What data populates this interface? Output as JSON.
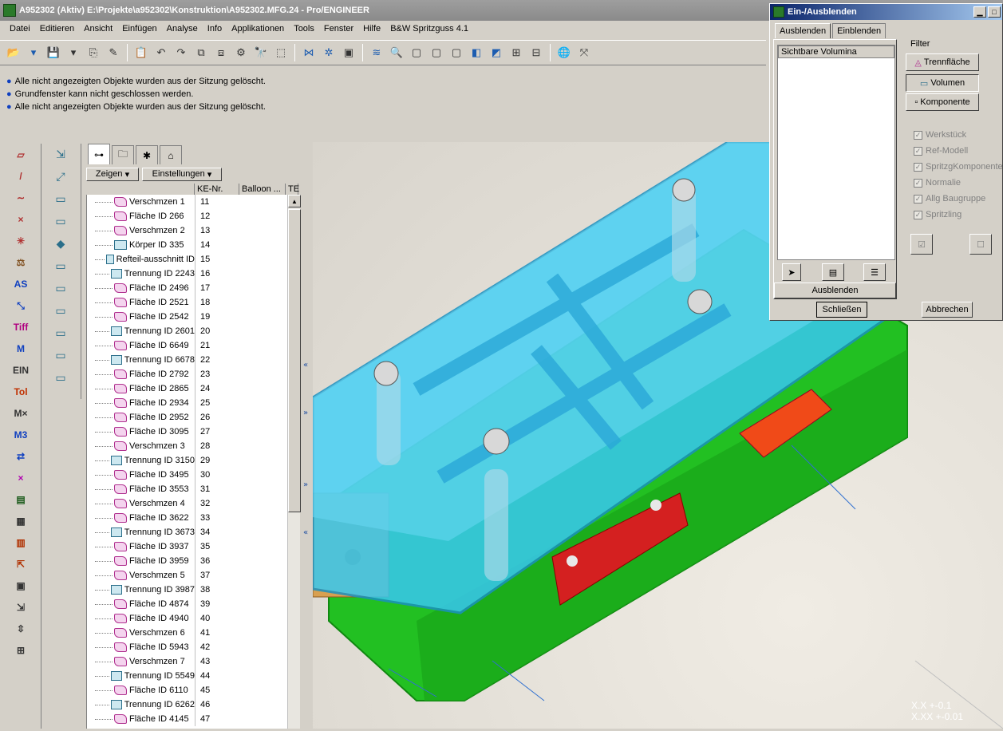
{
  "window": {
    "title": "A952302 (Aktiv) E:\\Projekte\\a952302\\Konstruktion\\A952302.MFG.24 - Pro/ENGINEER"
  },
  "menu": [
    "Datei",
    "Editieren",
    "Ansicht",
    "Einfügen",
    "Analyse",
    "Info",
    "Applikationen",
    "Tools",
    "Fenster",
    "Hilfe",
    "B&W Spritzguss 4.1"
  ],
  "messages": [
    "Alle nicht angezeigten Objekte wurden aus der Sitzung gelöscht.",
    "Grundfenster kann nicht geschlossen werden.",
    "Alle nicht angezeigten Objekte wurden aus der Sitzung gelöscht."
  ],
  "lefttools": [
    "▱",
    "/",
    "∼",
    "×",
    "✳",
    "⚖",
    "AS",
    "⤡",
    "Tiff",
    "M",
    "EIN",
    "Tol",
    "M×",
    "M3",
    "⇄",
    "×",
    "▤",
    "▦",
    "▥",
    "⇱",
    "▣",
    "⇲",
    "⇳",
    "⊞"
  ],
  "midtools": [
    "⇲",
    "⤢",
    "▭",
    "▭",
    "◆",
    "▭",
    "▭",
    "▭",
    "▭",
    "▭",
    "▭"
  ],
  "tree": {
    "show_button": "Zeigen",
    "settings_button": "Einstellungen",
    "columns": [
      "KE-Nr.",
      "Balloon ...",
      "TE"
    ],
    "rows": [
      {
        "name": "Verschmzen 1",
        "nr": "11",
        "type": "srf"
      },
      {
        "name": "Fläche ID 266",
        "nr": "12",
        "type": "srf"
      },
      {
        "name": "Verschmzen 2",
        "nr": "13",
        "type": "srf"
      },
      {
        "name": "Körper ID 335",
        "nr": "14",
        "type": "vol"
      },
      {
        "name": "Refteil-ausschnitt ID",
        "nr": "15",
        "type": "vol"
      },
      {
        "name": "Trennung ID 2243",
        "nr": "16",
        "type": "vol"
      },
      {
        "name": "Fläche ID 2496",
        "nr": "17",
        "type": "srf"
      },
      {
        "name": "Fläche ID 2521",
        "nr": "18",
        "type": "srf"
      },
      {
        "name": "Fläche ID 2542",
        "nr": "19",
        "type": "srf"
      },
      {
        "name": "Trennung ID 2601",
        "nr": "20",
        "type": "vol"
      },
      {
        "name": "Fläche ID 6649",
        "nr": "21",
        "type": "srf"
      },
      {
        "name": "Trennung ID 6678",
        "nr": "22",
        "type": "vol"
      },
      {
        "name": "Fläche ID 2792",
        "nr": "23",
        "type": "srf"
      },
      {
        "name": "Fläche ID 2865",
        "nr": "24",
        "type": "srf"
      },
      {
        "name": "Fläche ID 2934",
        "nr": "25",
        "type": "srf"
      },
      {
        "name": "Fläche ID 2952",
        "nr": "26",
        "type": "srf"
      },
      {
        "name": "Fläche ID 3095",
        "nr": "27",
        "type": "srf"
      },
      {
        "name": "Verschmzen 3",
        "nr": "28",
        "type": "srf"
      },
      {
        "name": "Trennung ID 3150",
        "nr": "29",
        "type": "vol"
      },
      {
        "name": "Fläche ID 3495",
        "nr": "30",
        "type": "srf"
      },
      {
        "name": "Fläche ID 3553",
        "nr": "31",
        "type": "srf"
      },
      {
        "name": "Verschmzen 4",
        "nr": "32",
        "type": "srf"
      },
      {
        "name": "Fläche ID 3622",
        "nr": "33",
        "type": "srf"
      },
      {
        "name": "Trennung ID 3673",
        "nr": "34",
        "type": "vol"
      },
      {
        "name": "Fläche ID 3937",
        "nr": "35",
        "type": "srf"
      },
      {
        "name": "Fläche ID 3959",
        "nr": "36",
        "type": "srf"
      },
      {
        "name": "Verschmzen 5",
        "nr": "37",
        "type": "srf"
      },
      {
        "name": "Trennung ID 3987",
        "nr": "38",
        "type": "vol"
      },
      {
        "name": "Fläche ID 4874",
        "nr": "39",
        "type": "srf"
      },
      {
        "name": "Fläche ID 4940",
        "nr": "40",
        "type": "srf"
      },
      {
        "name": "Verschmzen 6",
        "nr": "41",
        "type": "srf"
      },
      {
        "name": "Fläche ID 5943",
        "nr": "42",
        "type": "srf"
      },
      {
        "name": "Verschmzen 7",
        "nr": "43",
        "type": "srf"
      },
      {
        "name": "Trennung ID 5549",
        "nr": "44",
        "type": "vol"
      },
      {
        "name": "Fläche ID 6110",
        "nr": "45",
        "type": "srf"
      },
      {
        "name": "Trennung ID 6262",
        "nr": "46",
        "type": "vol"
      },
      {
        "name": "Fläche ID 4145",
        "nr": "47",
        "type": "srf"
      }
    ]
  },
  "viewport": {
    "coord_x": "X.X    +-0.1",
    "coord_xx": "X.XX   +-0.01"
  },
  "dialog": {
    "title": "Ein-/Ausblenden",
    "tabs": [
      "Ausblenden",
      "Einblenden"
    ],
    "list_header": "Sichtbare Volumina",
    "filter_label": "Filter",
    "filter_buttons": [
      "Trennfläche",
      "Volumen",
      "Komponente"
    ],
    "checkboxes": [
      "Werkstück",
      "Ref-Modell",
      "SpritzgKomponente",
      "Normalie",
      "Allg Baugruppe",
      "Spritzling"
    ],
    "hide_button": "Ausblenden",
    "close_button": "Schließen",
    "cancel_button": "Abbrechen"
  }
}
